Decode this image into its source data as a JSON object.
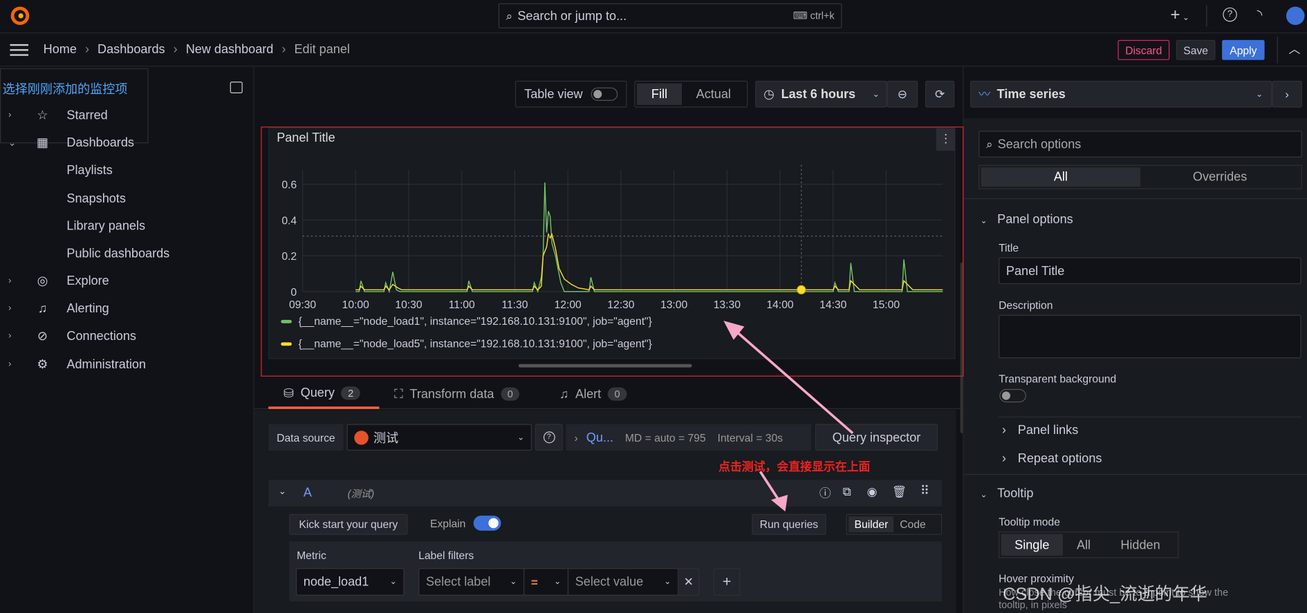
{
  "topbar": {
    "search_placeholder": "Search or jump to...",
    "shortcut": "ctrl+k",
    "plus": "+"
  },
  "breadcrumb": [
    "Home",
    "Dashboards",
    "New dashboard",
    "Edit panel"
  ],
  "actions": {
    "discard": "Discard",
    "save": "Save",
    "apply": "Apply"
  },
  "sidebar": {
    "annotation": "选择刚刚添加的监控项",
    "items": [
      {
        "label": "Starred",
        "icon": "star-icon",
        "expand": "›"
      },
      {
        "label": "Dashboards",
        "icon": "grid-icon",
        "expand": "⌄"
      },
      {
        "label": "Playlists"
      },
      {
        "label": "Snapshots"
      },
      {
        "label": "Library panels"
      },
      {
        "label": "Public dashboards"
      },
      {
        "label": "Explore",
        "icon": "compass-icon",
        "expand": "›"
      },
      {
        "label": "Alerting",
        "icon": "bell-icon",
        "expand": "›"
      },
      {
        "label": "Connections",
        "icon": "plug-icon",
        "expand": "›"
      },
      {
        "label": "Administration",
        "icon": "gear-icon",
        "expand": "›"
      }
    ]
  },
  "toolbar": {
    "table_view": "Table view",
    "table_view_on": false,
    "fill": "Fill",
    "actual": "Actual",
    "time_range": "Last 6 hours"
  },
  "panel": {
    "title": "Panel Title"
  },
  "chart_data": {
    "type": "line",
    "title": "Panel Title",
    "x_ticks": [
      "09:30",
      "10:00",
      "10:30",
      "11:00",
      "11:30",
      "12:00",
      "12:30",
      "13:00",
      "13:30",
      "14:00",
      "14:30",
      "15:00"
    ],
    "y_ticks": [
      "0",
      "0.2",
      "0.4",
      "0.6"
    ],
    "ylim": [
      0,
      0.68
    ],
    "xlim": [
      "09:30",
      "15:32"
    ],
    "grid": true,
    "legend_position": "bottom",
    "series": [
      {
        "name": "{__name__=\"node_load1\", instance=\"192.168.10.131:9100\", job=\"agent\"}",
        "color": "#73bf69",
        "x": [
          "10:00",
          "10:02",
          "10:03",
          "10:05",
          "10:16",
          "10:17",
          "10:19",
          "10:21",
          "10:23",
          "10:25",
          "11:03",
          "11:04",
          "11:06",
          "11:40",
          "11:41",
          "11:43",
          "11:45",
          "11:46",
          "11:47",
          "11:48",
          "11:49",
          "11:50",
          "11:51",
          "11:53",
          "11:56",
          "11:58",
          "12:12",
          "12:13",
          "12:15",
          "14:30",
          "14:31",
          "14:33",
          "14:39",
          "14:40",
          "14:42",
          "15:09",
          "15:10",
          "15:12",
          "15:32"
        ],
        "y": [
          0,
          0,
          0.06,
          0,
          0,
          0.05,
          0,
          0.11,
          0.01,
          0,
          0,
          0.06,
          0,
          0,
          0.05,
          0,
          0.08,
          0.2,
          0.61,
          0.33,
          0.45,
          0.42,
          0.27,
          0.2,
          0.05,
          0,
          0,
          0.08,
          0,
          0,
          0.05,
          0,
          0,
          0.16,
          0,
          0,
          0.18,
          0,
          0
        ]
      },
      {
        "name": "{__name__=\"node_load5\", instance=\"192.168.10.131:9100\", job=\"agent\"}",
        "color": "#fade2a",
        "x": [
          "10:00",
          "10:02",
          "10:03",
          "10:05",
          "10:16",
          "10:17",
          "10:19",
          "10:21",
          "10:24",
          "10:26",
          "11:03",
          "11:04",
          "11:06",
          "11:40",
          "11:41",
          "11:43",
          "11:45",
          "11:46",
          "11:48",
          "11:49",
          "11:50",
          "11:51",
          "11:53",
          "11:55",
          "11:58",
          "12:02",
          "12:06",
          "12:12",
          "12:13",
          "12:15",
          "14:30",
          "14:31",
          "14:33",
          "14:39",
          "14:40",
          "14:42",
          "14:45",
          "15:09",
          "15:10",
          "15:12",
          "15:15",
          "15:32"
        ],
        "y": [
          0.01,
          0.01,
          0.03,
          0.01,
          0.01,
          0.03,
          0.01,
          0.04,
          0.02,
          0.01,
          0.01,
          0.03,
          0.01,
          0.01,
          0.03,
          0.01,
          0.03,
          0.2,
          0.25,
          0.32,
          0.3,
          0.32,
          0.24,
          0.13,
          0.07,
          0.04,
          0.02,
          0.01,
          0.03,
          0.01,
          0.01,
          0.03,
          0.01,
          0.01,
          0.06,
          0.04,
          0.01,
          0.01,
          0.06,
          0.04,
          0.01,
          0.01
        ]
      }
    ]
  },
  "tabs": [
    {
      "label": "Query",
      "count": "2"
    },
    {
      "label": "Transform data",
      "count": "0"
    },
    {
      "label": "Alert",
      "count": "0"
    }
  ],
  "query": {
    "datasource_label": "Data source",
    "datasource": "测试",
    "options_link": "Qu...",
    "md": "MD = auto = 795",
    "interval": "Interval = 30s",
    "inspector": "Query inspector",
    "annotation": "点击测试，会直接显示在上面",
    "row": {
      "ref": "A",
      "ds": "(测试)"
    },
    "kick_start": "Kick start your query",
    "explain": "Explain",
    "explain_on": true,
    "run": "Run queries",
    "builder": "Builder",
    "code": "Code",
    "metric_label": "Metric",
    "metric": "node_load1",
    "label_filters": "Label filters",
    "select_label": "Select label",
    "op": "=",
    "select_value": "Select value"
  },
  "options": {
    "viz": "Time series",
    "search_placeholder": "Search options",
    "all": "All",
    "overrides": "Overrides",
    "panel_options": "Panel options",
    "title_label": "Title",
    "title_value": "Panel Title",
    "description": "Description",
    "transparent": "Transparent background",
    "transparent_on": false,
    "panel_links": "Panel links",
    "repeat": "Repeat options",
    "tooltip": "Tooltip",
    "tooltip_mode": "Tooltip mode",
    "modes": [
      "Single",
      "All",
      "Hidden"
    ],
    "mode_selected": "Single",
    "hover": "Hover proximity",
    "hover_desc": "How close the cursor must be to a point to show the tooltip, in pixels"
  },
  "watermark": "CSDN @指尖_流逝的年华"
}
